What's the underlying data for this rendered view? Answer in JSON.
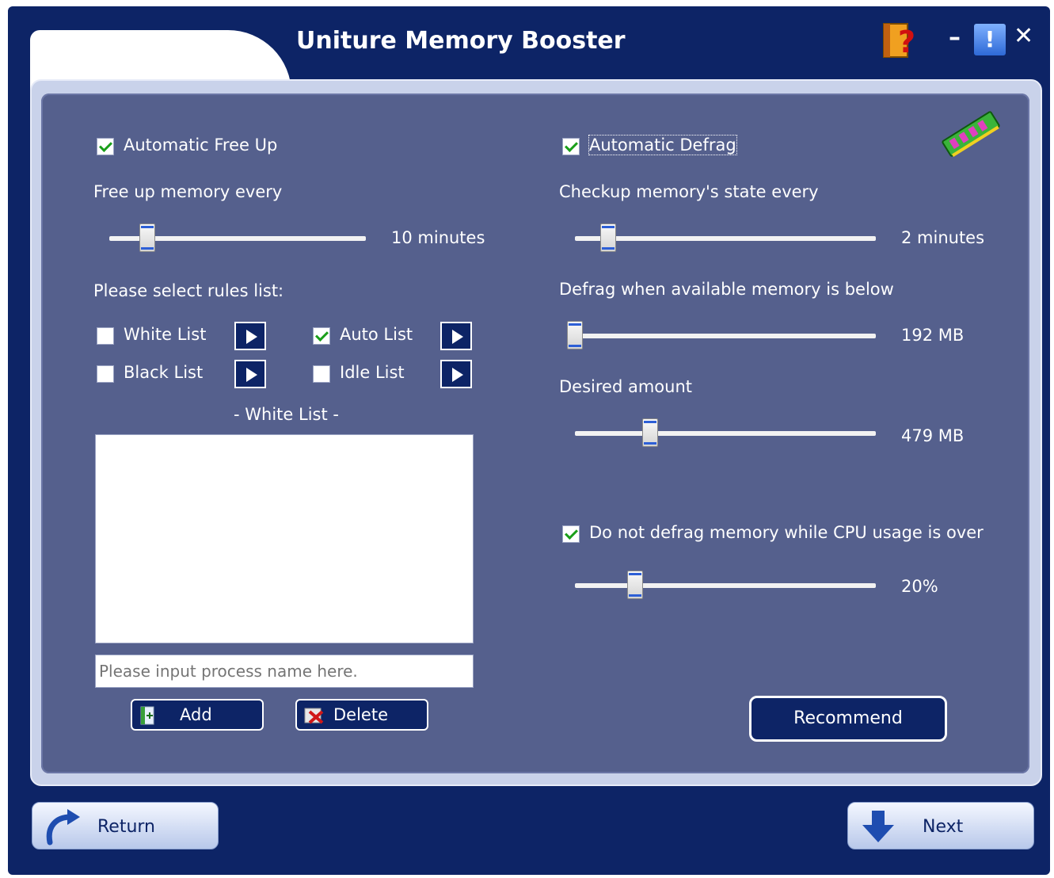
{
  "window": {
    "title": "Uniture Memory Booster",
    "min_glyph": "–",
    "info_glyph": "!",
    "close_glyph": "✕"
  },
  "left": {
    "auto_free_up": {
      "label": "Automatic Free Up",
      "checked": true
    },
    "free_up_label": "Free up memory every",
    "free_up_value": "10 minutes",
    "free_up_level": 0.15,
    "rules_label": "Please select rules list:",
    "rules": [
      {
        "label": "White List",
        "checked": false
      },
      {
        "label": "Auto List",
        "checked": true
      },
      {
        "label": "Black List",
        "checked": false
      },
      {
        "label": "Idle List",
        "checked": false
      }
    ],
    "list_title": "- White List -",
    "process_placeholder": "Please input process name here.",
    "add_label": "Add",
    "delete_label": "Delete"
  },
  "right": {
    "auto_defrag": {
      "label": "Automatic Defrag",
      "checked": true
    },
    "checkup_label": "Checkup memory's state every",
    "checkup_value": "2 minutes",
    "checkup_level": 0.1,
    "below_label": "Defrag when available memory is below",
    "below_value": "192 MB",
    "below_level": 0.0,
    "desired_label": "Desired amount",
    "desired_value": "479 MB",
    "desired_level": 0.25,
    "cpu": {
      "label": "Do not defrag memory while CPU usage is over",
      "checked": true
    },
    "cpu_value": "20%",
    "cpu_level": 0.2,
    "recommend_label": "Recommend"
  },
  "nav": {
    "return_label": "Return",
    "next_label": "Next"
  }
}
